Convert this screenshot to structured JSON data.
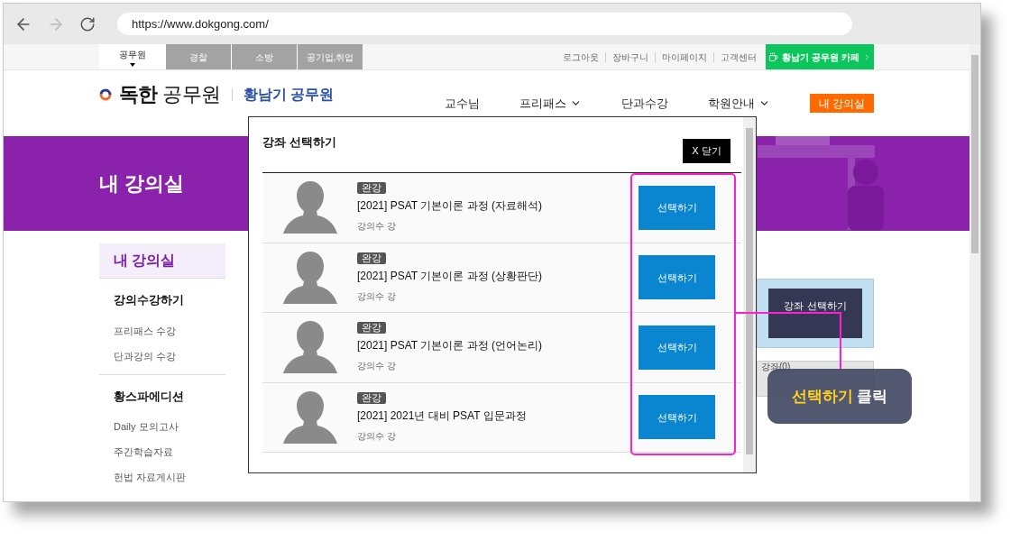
{
  "browser": {
    "url": "https://www.dokgong.com/",
    "back_disabled": false,
    "forward_disabled": true
  },
  "top_tabs": [
    {
      "label": "공무원",
      "selected": true
    },
    {
      "label": "경찰",
      "selected": false
    },
    {
      "label": "소방",
      "selected": false
    },
    {
      "label": "공기업,취업",
      "selected": false
    }
  ],
  "top_links": [
    "로그아웃",
    "장바구니",
    "마이페이지",
    "고객센터"
  ],
  "cafe_button": "황남기 공무원 카페",
  "logo": {
    "brand": "독한",
    "brand_rest": "공무원",
    "sub": "황남기 공무원"
  },
  "nav": [
    {
      "label": "교수님",
      "dropdown": false
    },
    {
      "label": "프리패스",
      "dropdown": true
    },
    {
      "label": "단과수강",
      "dropdown": false
    },
    {
      "label": "학원안내",
      "dropdown": true
    }
  ],
  "nav_button": "내 강의실",
  "banner_title": "내 강의실",
  "sidebar": {
    "title": "내 강의실",
    "sections": [
      {
        "heading": "강의수강하기",
        "items": [
          "프리패스 수강",
          "단과강의 수강"
        ]
      },
      {
        "heading": "황스파에디션",
        "items": [
          "Daily 모의고사",
          "주간학습자료",
          "헌법 자료게시판"
        ]
      }
    ]
  },
  "main": {
    "select_button": "강좌 선택하기",
    "saved_tab": "강좌(0)"
  },
  "modal": {
    "title": "강좌 선택하기",
    "close": "X 닫기",
    "courses": [
      {
        "badge": "완강",
        "title": "[2021] PSAT 기본이론 과정 (자료해석)",
        "meta": "강의수 강",
        "button": "선택하기"
      },
      {
        "badge": "완강",
        "title": "[2021] PSAT 기본이론 과정 (상황판단)",
        "meta": "강의수 강",
        "button": "선택하기"
      },
      {
        "badge": "완강",
        "title": "[2021] PSAT 기본이론 과정 (언어논리)",
        "meta": "강의수 강",
        "button": "선택하기"
      },
      {
        "badge": "완강",
        "title": "[2021] 2021년 대비 PSAT 입문과정",
        "meta": "강의수 강",
        "button": "선택하기"
      }
    ]
  },
  "callout": {
    "highlight": "선택하기",
    "text": "클릭"
  }
}
